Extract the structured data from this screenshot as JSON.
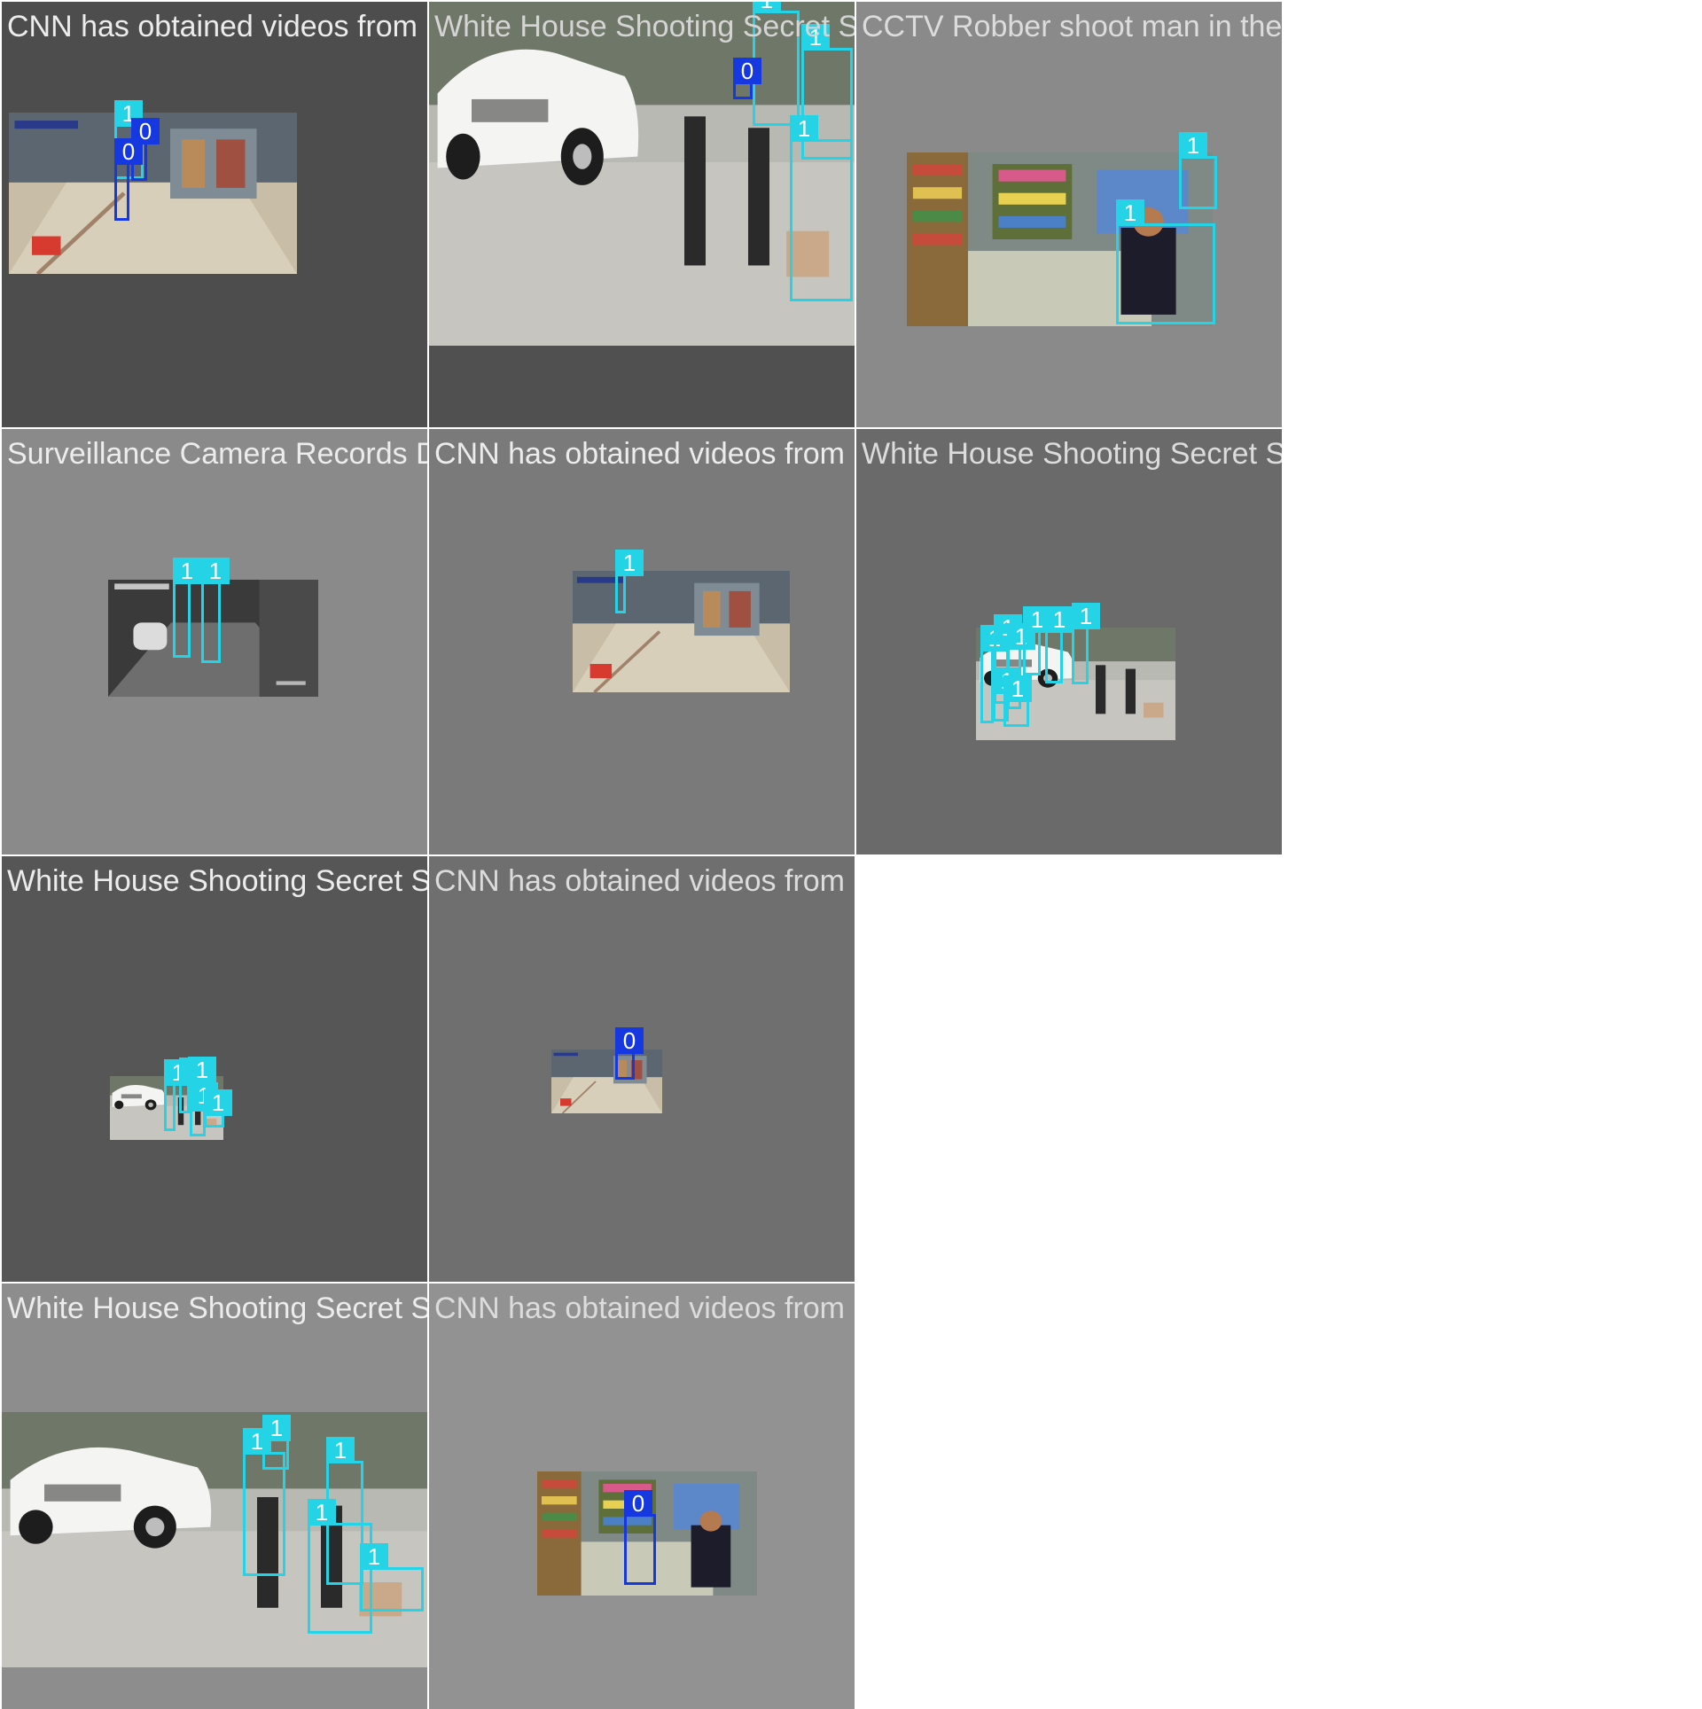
{
  "tiles": [
    {
      "title": "CNN has obtained videos from inside the",
      "bg": "#4d4d4d",
      "title_color": "#ececec",
      "scene": "mall",
      "detections": [
        "1",
        "0",
        "0"
      ]
    },
    {
      "title": "White House Shooting  Secret Service Sho",
      "bg": "#505050",
      "title_color": "#d4d4d4",
      "scene": "police",
      "detections": [
        "1",
        "0",
        "1",
        "1"
      ]
    },
    {
      "title": "CCTV Robber shoot man in the eyes with",
      "bg": "#8a8a8a",
      "title_color": "#dcdcdc",
      "scene": "store",
      "detections": [
        "1",
        "1"
      ]
    },
    {
      "title": "Surveillance Camera Records Deadly Shoo",
      "bg": "#8a8a8a",
      "title_color": "#ececec",
      "scene": "night",
      "detections": [
        "1",
        "1"
      ]
    },
    {
      "title": "CNN has obtained videos from inside the",
      "bg": "#7a7a7a",
      "title_color": "#ececec",
      "scene": "mall",
      "detections": [
        "1"
      ]
    },
    {
      "title": "White House Shooting  Secret Service Sho",
      "bg": "#6a6a6a",
      "title_color": "#dcdcdc",
      "scene": "police",
      "detections": [
        "1",
        "1",
        "1",
        "1",
        "1",
        "1",
        "1",
        "1"
      ]
    },
    {
      "title": "White House Shooting  Secret Service Sho",
      "bg": "#565656",
      "title_color": "#ececec",
      "scene": "police",
      "detections": [
        "1",
        "1",
        "1",
        "1",
        "1"
      ]
    },
    {
      "title": "CNN has obtained videos from inside the",
      "bg": "#6f6f6f",
      "title_color": "#dcdcdc",
      "scene": "mall",
      "detections": [
        "0"
      ]
    },
    {
      "title": "White House Shooting  Secret Service Sho",
      "bg": "#8d8d8d",
      "title_color": "#ececec",
      "scene": "police",
      "detections": [
        "1",
        "1",
        "1",
        "1",
        "1"
      ]
    },
    {
      "title": "CNN has obtained videos from inside the",
      "bg": "#929292",
      "title_color": "#dcdcdc",
      "scene": "store",
      "detections": [
        "0"
      ]
    }
  ],
  "colors": {
    "class_1": "#24d3e6",
    "class_0": "#1538e0"
  }
}
